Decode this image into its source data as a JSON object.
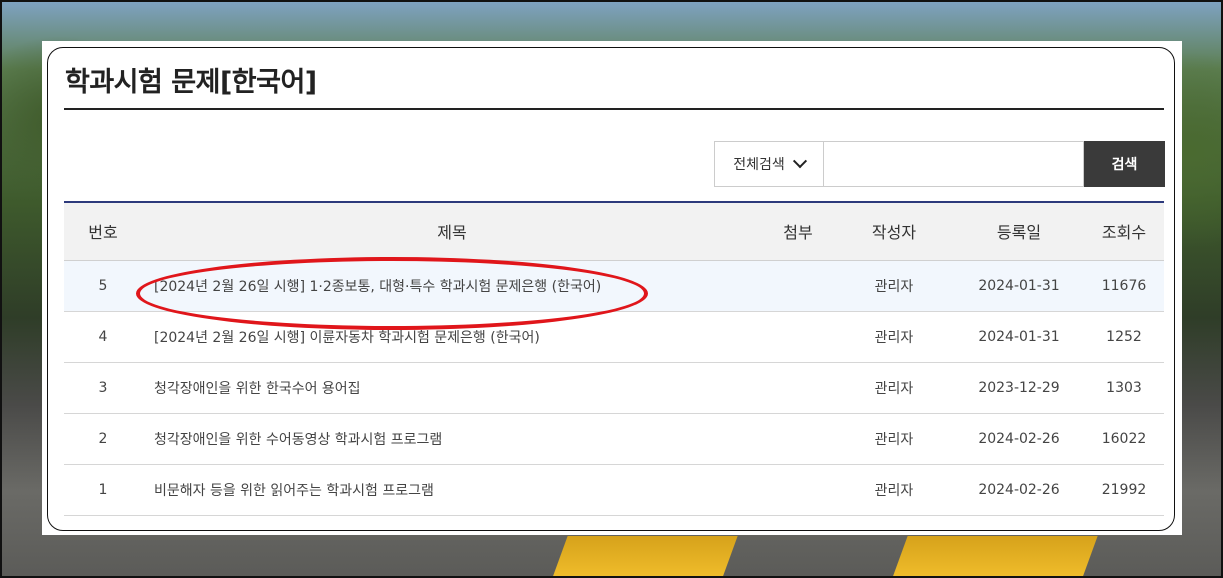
{
  "page": {
    "title": "학과시험 문제[한국어]"
  },
  "search": {
    "scope_label": "전체검색",
    "input_value": "",
    "button_label": "검색"
  },
  "table": {
    "headers": {
      "no": "번호",
      "title": "제목",
      "attachment": "첨부",
      "author": "작성자",
      "date": "등록일",
      "views": "조회수"
    },
    "rows": [
      {
        "no": "5",
        "title": "[2024년 2월 26일 시행] 1·2종보통, 대형·특수 학과시험 문제은행 (한국어)",
        "author": "관리자",
        "date": "2024-01-31",
        "views": "11676"
      },
      {
        "no": "4",
        "title": "[2024년 2월 26일 시행] 이륜자동차 학과시험 문제은행 (한국어)",
        "author": "관리자",
        "date": "2024-01-31",
        "views": "1252"
      },
      {
        "no": "3",
        "title": "청각장애인을 위한 한국수어 용어집",
        "author": "관리자",
        "date": "2023-12-29",
        "views": "1303"
      },
      {
        "no": "2",
        "title": "청각장애인을 위한 수어동영상 학과시험 프로그램",
        "author": "관리자",
        "date": "2024-02-26",
        "views": "16022"
      },
      {
        "no": "1",
        "title": "비문해자 등을 위한 읽어주는 학과시험 프로그램",
        "author": "관리자",
        "date": "2024-02-26",
        "views": "21992"
      }
    ]
  },
  "annotation": {
    "color": "#e0161b"
  }
}
